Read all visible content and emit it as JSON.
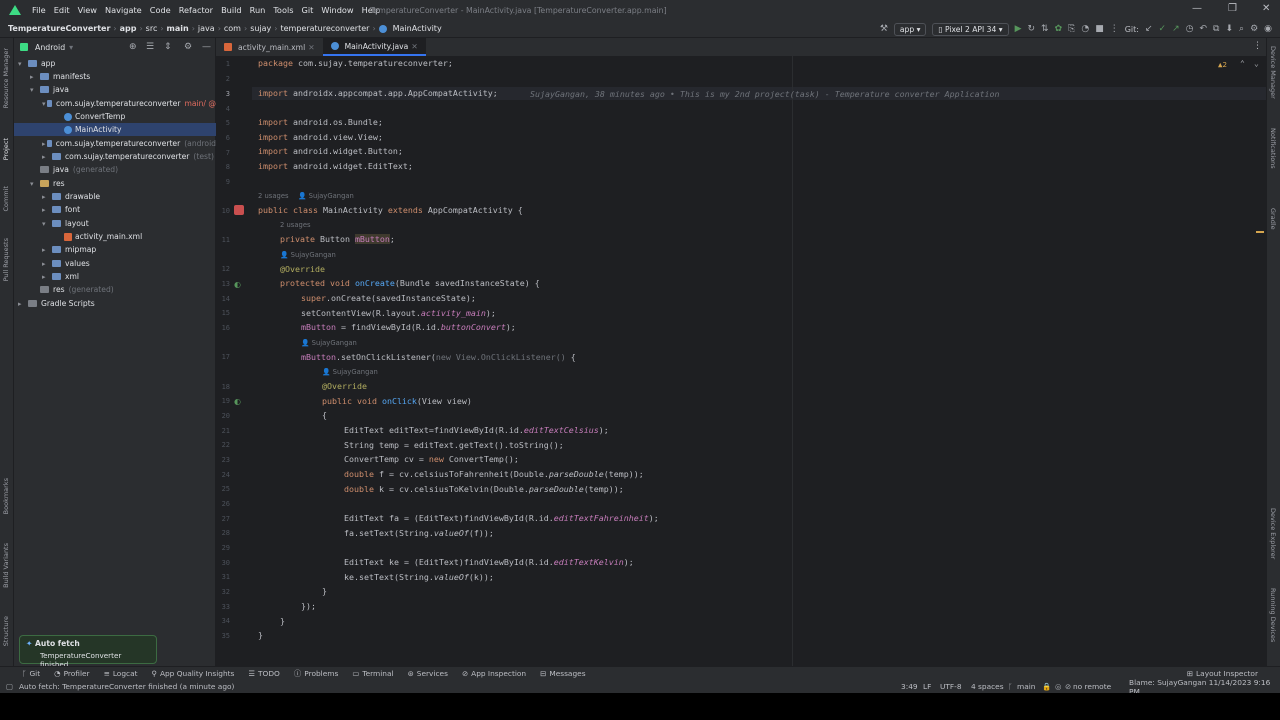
{
  "menubar": {
    "items": [
      "File",
      "Edit",
      "View",
      "Navigate",
      "Code",
      "Refactor",
      "Build",
      "Run",
      "Tools",
      "Git",
      "Window",
      "Help"
    ],
    "title": "TemperatureConverter - MainActivity.java [TemperatureConverter.app.main]"
  },
  "navbar": {
    "crumbs": [
      "TemperatureConverter",
      "app",
      "src",
      "main",
      "java",
      "com",
      "sujay",
      "temperatureconverter",
      "MainActivity"
    ],
    "run_config": "app",
    "device": "Pixel 2 API 34",
    "git_label": "Git:"
  },
  "left_strip": [
    "Resource Manager",
    "Project",
    "Commit",
    "Pull Requests",
    "Bookmarks",
    "Build Variants",
    "Structure"
  ],
  "right_strip": [
    "Device Manager",
    "Notifications",
    "Gradle",
    "Device Explorer",
    "Running Devices"
  ],
  "project": {
    "view": "Android",
    "tree": [
      {
        "label": "app",
        "indent": 0,
        "kind": "folder",
        "arrow": "▾"
      },
      {
        "label": "manifests",
        "indent": 1,
        "kind": "folder",
        "arrow": "▸"
      },
      {
        "label": "java",
        "indent": 1,
        "kind": "folder",
        "arrow": "▾"
      },
      {
        "label": "com.sujay.temperatureconverter",
        "suffix": "main/ @",
        "indent": 2,
        "kind": "folder",
        "arrow": "▾",
        "mod": true
      },
      {
        "label": "ConvertTemp",
        "indent": 3,
        "kind": "class"
      },
      {
        "label": "MainActivity",
        "indent": 3,
        "kind": "class",
        "selected": true
      },
      {
        "label": "com.sujay.temperatureconverter",
        "suffix": "(android",
        "indent": 2,
        "kind": "folder",
        "arrow": "▸"
      },
      {
        "label": "com.sujay.temperatureconverter",
        "suffix": "(test)",
        "indent": 2,
        "kind": "folder",
        "arrow": "▸"
      },
      {
        "label": "java",
        "suffix": "(generated)",
        "indent": 1,
        "kind": "gen"
      },
      {
        "label": "res",
        "indent": 1,
        "kind": "res",
        "arrow": "▾"
      },
      {
        "label": "drawable",
        "indent": 2,
        "kind": "folder",
        "arrow": "▸"
      },
      {
        "label": "font",
        "indent": 2,
        "kind": "folder",
        "arrow": "▸"
      },
      {
        "label": "layout",
        "indent": 2,
        "kind": "folder",
        "arrow": "▾"
      },
      {
        "label": "activity_main.xml",
        "indent": 3,
        "kind": "xml"
      },
      {
        "label": "mipmap",
        "indent": 2,
        "kind": "folder",
        "arrow": "▸"
      },
      {
        "label": "values",
        "indent": 2,
        "kind": "folder",
        "arrow": "▸"
      },
      {
        "label": "xml",
        "indent": 2,
        "kind": "folder",
        "arrow": "▸"
      },
      {
        "label": "res",
        "suffix": "(generated)",
        "indent": 1,
        "kind": "gen"
      },
      {
        "label": "Gradle Scripts",
        "indent": 0,
        "kind": "gradle",
        "arrow": "▸"
      }
    ]
  },
  "tabs": [
    {
      "label": "activity_main.xml",
      "active": false
    },
    {
      "label": "MainActivity.java",
      "active": true
    }
  ],
  "editor": {
    "warnings": "▲2",
    "blame": "SujayGangan, 38 minutes ago • This is my 2nd project(task) - Temperature converter Application",
    "usages_2": "2 usages",
    "author": "SujayGangan"
  },
  "toolwindows": [
    "Git",
    "Profiler",
    "Logcat",
    "App Quality Insights",
    "TODO",
    "Problems",
    "Terminal",
    "Services",
    "App Inspection",
    "Messages"
  ],
  "layout_inspector": "Layout Inspector",
  "status": {
    "message": "Auto fetch: TemperatureConverter finished (a minute ago)",
    "position": "3:49",
    "line_sep": "LF",
    "encoding": "UTF-8",
    "indent": "4 spaces",
    "branch": "main",
    "remote": "no remote",
    "blame": "Blame: SujayGangan 11/14/2023 9:16 PM"
  },
  "toast": {
    "title": "Auto fetch",
    "body": "TemperatureConverter finished"
  }
}
